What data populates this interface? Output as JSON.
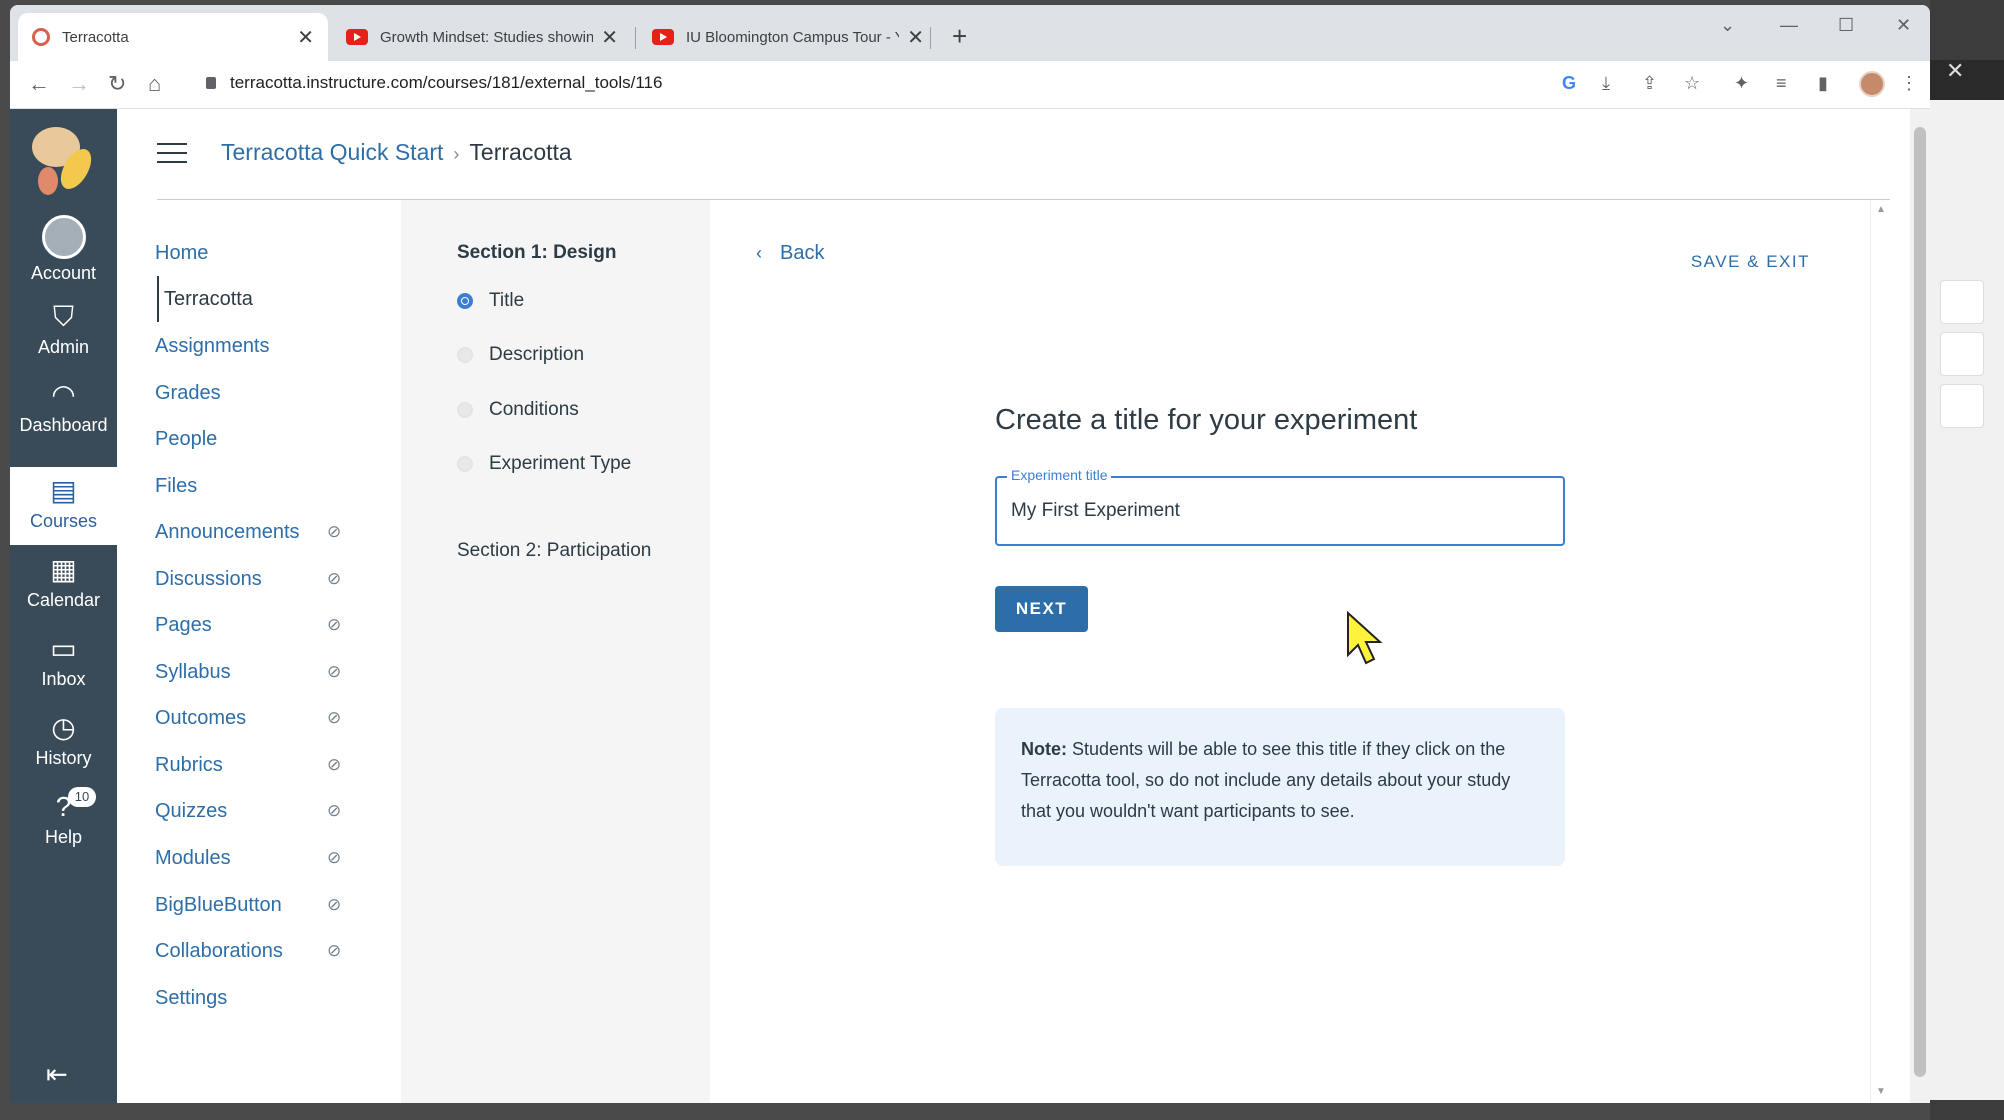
{
  "browser": {
    "tabs": [
      {
        "title": "Terracotta",
        "icon": "terracotta-icon",
        "active": true
      },
      {
        "title": "Growth Mindset: Studies showing",
        "icon": "youtube-icon",
        "active": false
      },
      {
        "title": "IU Bloomington Campus Tour - Y",
        "icon": "youtube-icon",
        "active": false
      }
    ],
    "url": "terracotta.instructure.com/courses/181/external_tools/116"
  },
  "global_nav": {
    "items": [
      {
        "label": "Account",
        "icon": "user-avatar-icon"
      },
      {
        "label": "Admin",
        "icon": "shield-icon"
      },
      {
        "label": "Dashboard",
        "icon": "dashboard-icon"
      },
      {
        "label": "Courses",
        "icon": "book-icon"
      },
      {
        "label": "Calendar",
        "icon": "calendar-icon"
      },
      {
        "label": "Inbox",
        "icon": "inbox-icon"
      },
      {
        "label": "History",
        "icon": "clock-icon"
      },
      {
        "label": "Help",
        "icon": "help-icon",
        "badge": "10"
      }
    ],
    "active": "Courses"
  },
  "header": {
    "course": "Terracotta Quick Start",
    "page": "Terracotta"
  },
  "course_nav": {
    "items": [
      {
        "label": "Home",
        "hidden": false
      },
      {
        "label": "Terracotta",
        "hidden": false
      },
      {
        "label": "Assignments",
        "hidden": false
      },
      {
        "label": "Grades",
        "hidden": false
      },
      {
        "label": "People",
        "hidden": false
      },
      {
        "label": "Files",
        "hidden": false
      },
      {
        "label": "Announcements",
        "hidden": true
      },
      {
        "label": "Discussions",
        "hidden": true
      },
      {
        "label": "Pages",
        "hidden": true
      },
      {
        "label": "Syllabus",
        "hidden": true
      },
      {
        "label": "Outcomes",
        "hidden": true
      },
      {
        "label": "Rubrics",
        "hidden": true
      },
      {
        "label": "Quizzes",
        "hidden": true
      },
      {
        "label": "Modules",
        "hidden": true
      },
      {
        "label": "BigBlueButton",
        "hidden": true
      },
      {
        "label": "Collaborations",
        "hidden": true
      },
      {
        "label": "Settings",
        "hidden": false
      }
    ],
    "active": "Terracotta"
  },
  "steps": {
    "section1": "Section 1: Design",
    "items": [
      "Title",
      "Description",
      "Conditions",
      "Experiment Type"
    ],
    "active": "Title",
    "section2": "Section 2: Participation"
  },
  "main": {
    "back_label": "Back",
    "save_exit_label": "SAVE & EXIT",
    "heading": "Create a title for your experiment",
    "field_label": "Experiment title",
    "field_value": "My First Experiment",
    "next_label": "NEXT",
    "note_bold": "Note:",
    "note_text": " Students will be able to see this title if they click on the Terracotta tool, so do not include any details about your study that you wouldn't want participants to see."
  },
  "colors": {
    "global_nav_bg": "#394b58",
    "link": "#2d6ea8",
    "accent": "#3b7fd4",
    "note_bg": "#eaf2fb"
  }
}
